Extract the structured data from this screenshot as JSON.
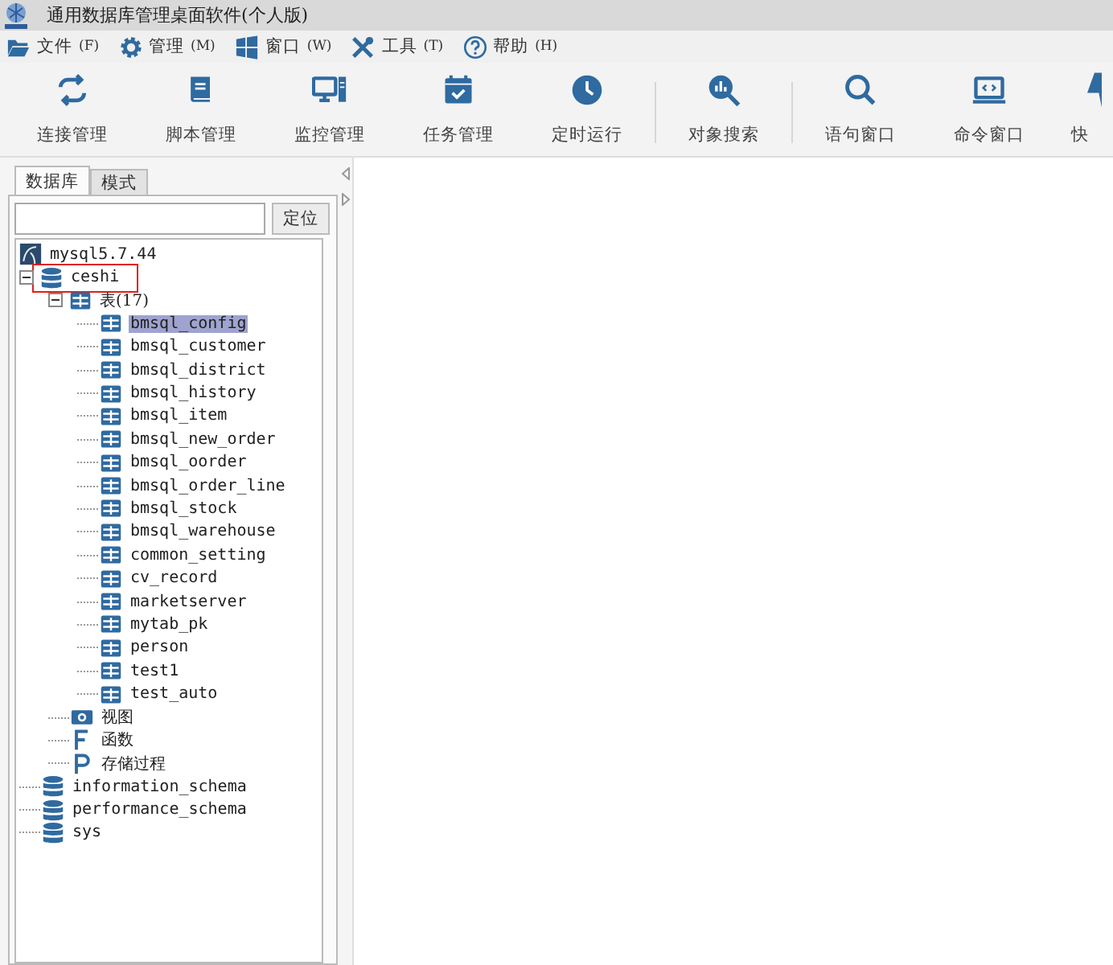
{
  "window": {
    "title": "通用数据库管理桌面软件(个人版)"
  },
  "menu": [
    {
      "label": "文件",
      "key": "(F)"
    },
    {
      "label": "管理",
      "key": "(M)"
    },
    {
      "label": "窗口",
      "key": "(W)"
    },
    {
      "label": "工具",
      "key": "(T)"
    },
    {
      "label": "帮助",
      "key": "(H)"
    }
  ],
  "toolbar": [
    {
      "kind": "button",
      "label": "连接管理"
    },
    {
      "kind": "button",
      "label": "脚本管理"
    },
    {
      "kind": "button",
      "label": "监控管理"
    },
    {
      "kind": "button",
      "label": "任务管理"
    },
    {
      "kind": "button",
      "label": "定时运行"
    },
    {
      "kind": "separator"
    },
    {
      "kind": "button",
      "label": "对象搜索"
    },
    {
      "kind": "separator"
    },
    {
      "kind": "button",
      "label": "语句窗口"
    },
    {
      "kind": "button",
      "label": "命令窗口"
    },
    {
      "kind": "button",
      "label": "快"
    }
  ],
  "sidebar": {
    "tabs": [
      {
        "label": "数据库",
        "selected": true
      },
      {
        "label": "模式",
        "selected": false
      }
    ],
    "locate_button": "定位",
    "tree": {
      "label": "mysql5.7.44",
      "kind": "server",
      "selected": false,
      "children": [
        {
          "label": "ceshi",
          "kind": "database",
          "selected": false,
          "expanded": true,
          "annotated": true,
          "children": [
            {
              "label": "表(17)",
              "kind": "folder",
              "selected": false,
              "expanded": true,
              "children": [
                {
                  "label": "bmsql_config",
                  "kind": "table",
                  "selected": true
                },
                {
                  "label": "bmsql_customer",
                  "kind": "table",
                  "selected": false
                },
                {
                  "label": "bmsql_district",
                  "kind": "table",
                  "selected": false
                },
                {
                  "label": "bmsql_history",
                  "kind": "table",
                  "selected": false
                },
                {
                  "label": "bmsql_item",
                  "kind": "table",
                  "selected": false
                },
                {
                  "label": "bmsql_new_order",
                  "kind": "table",
                  "selected": false
                },
                {
                  "label": "bmsql_oorder",
                  "kind": "table",
                  "selected": false
                },
                {
                  "label": "bmsql_order_line",
                  "kind": "table",
                  "selected": false
                },
                {
                  "label": "bmsql_stock",
                  "kind": "table",
                  "selected": false
                },
                {
                  "label": "bmsql_warehouse",
                  "kind": "table",
                  "selected": false
                },
                {
                  "label": "common_setting",
                  "kind": "table",
                  "selected": false
                },
                {
                  "label": "cv_record",
                  "kind": "table",
                  "selected": false
                },
                {
                  "label": "marketserver",
                  "kind": "table",
                  "selected": false
                },
                {
                  "label": "mytab_pk",
                  "kind": "table",
                  "selected": false
                },
                {
                  "label": "person",
                  "kind": "table",
                  "selected": false
                },
                {
                  "label": "test1",
                  "kind": "table",
                  "selected": false
                },
                {
                  "label": "test_auto",
                  "kind": "table",
                  "selected": false
                }
              ]
            },
            {
              "label": "视图",
              "kind": "view",
              "selected": false
            },
            {
              "label": "函数",
              "kind": "function",
              "selected": false
            },
            {
              "label": "存储过程",
              "kind": "procedure",
              "selected": false
            }
          ]
        },
        {
          "label": "information_schema",
          "kind": "database",
          "selected": false
        },
        {
          "label": "performance_schema",
          "kind": "database",
          "selected": false
        },
        {
          "label": "sys",
          "kind": "database",
          "selected": false
        }
      ]
    }
  }
}
